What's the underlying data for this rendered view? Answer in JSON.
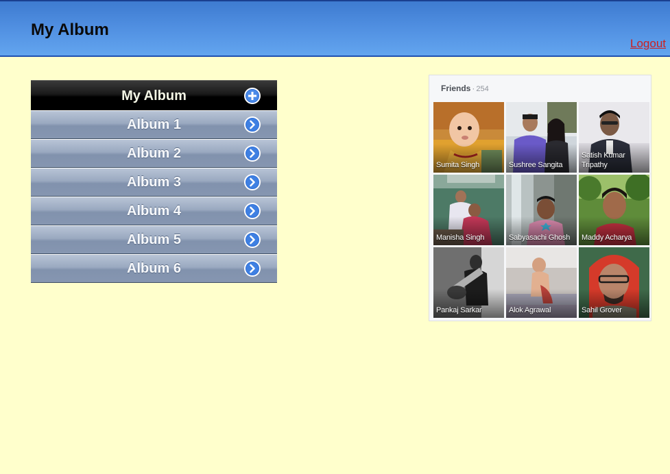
{
  "header": {
    "title": "My Album",
    "logout_label": "Logout"
  },
  "album_menu": {
    "header_label": "My Album",
    "header_icon": "plus-circle-icon",
    "item_icon": "chevron-right-circle-icon",
    "items": [
      {
        "label": "Album 1"
      },
      {
        "label": "Album 2"
      },
      {
        "label": "Album 3"
      },
      {
        "label": "Album 4"
      },
      {
        "label": "Album 5"
      },
      {
        "label": "Album 6"
      }
    ]
  },
  "friends": {
    "heading": "Friends",
    "separator": "·",
    "count": "254",
    "list": [
      {
        "name": "Sumita Singh"
      },
      {
        "name": "Sushree Sangita"
      },
      {
        "name": "Satish Kumar Tripathy"
      },
      {
        "name": "Manisha Singh"
      },
      {
        "name": "Sabyasachi Ghosh"
      },
      {
        "name": "Maddy Acharya"
      },
      {
        "name": "Pankaj Sarkar"
      },
      {
        "name": "Alok Agrawal"
      },
      {
        "name": "Sahil Grover"
      }
    ]
  },
  "colors": {
    "page_background": "#ffffcc",
    "header_gradient_top": "#3e7bd0",
    "header_gradient_bottom": "#63a5ef",
    "logout_link": "#cc1f1f",
    "menu_header": "#000000",
    "menu_item": "#8e9db6",
    "icon_blue": "#2f6fd6"
  }
}
